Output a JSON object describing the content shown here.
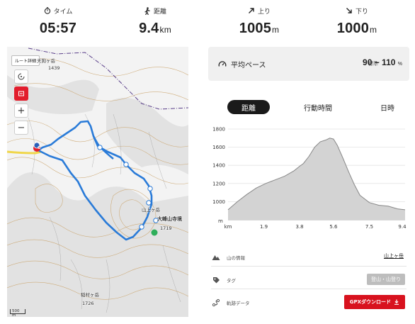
{
  "stats": [
    {
      "label": "タイム",
      "value": "05:57",
      "unit": "",
      "icon": "stopwatch-icon"
    },
    {
      "label": "距離",
      "value": "9.4",
      "unit": "km",
      "icon": "walker-icon"
    },
    {
      "label": "上り",
      "value": "1005",
      "unit": "m",
      "icon": "arrow-up-right-icon"
    },
    {
      "label": "下り",
      "value": "1000",
      "unit": "m",
      "icon": "arrow-down-right-icon"
    }
  ],
  "map": {
    "route_detail_label": "ルート詳細",
    "labels": {
      "peak_top": "天狗ヶ岳",
      "elev_top": "1439",
      "peak_mid": "山上ヶ岳",
      "temple": "大峰山寺境",
      "elev_mid": "1719",
      "peak_bottom": "稲村ヶ岳",
      "elev_bottom": "1726"
    },
    "start_marker": "G",
    "scale_label": "500 m",
    "zoom_in_label": "+",
    "zoom_out_label": "−"
  },
  "pace": {
    "title": "平均ペース",
    "sub_label": "標準",
    "range": "90 ~ 110",
    "unit": "%"
  },
  "tabs": [
    {
      "label": "距離",
      "active": true
    },
    {
      "label": "行動時間",
      "active": false
    },
    {
      "label": "日時",
      "active": false
    }
  ],
  "chart_data": {
    "type": "area",
    "xlabel": "km",
    "ylabel": "m",
    "x_ticks": [
      "1.9",
      "3.8",
      "5.6",
      "7.5",
      "9.4"
    ],
    "y_ticks": [
      "1800",
      "1600",
      "1400",
      "1200",
      "1000"
    ],
    "xlim": [
      0,
      9.4
    ],
    "ylim": [
      800,
      1800
    ],
    "x": [
      0.0,
      0.5,
      1.0,
      1.5,
      2.0,
      2.5,
      3.0,
      3.5,
      3.8,
      4.0,
      4.3,
      4.6,
      4.9,
      5.2,
      5.4,
      5.6,
      5.8,
      6.1,
      6.4,
      6.7,
      7.0,
      7.5,
      8.0,
      8.5,
      9.0,
      9.4
    ],
    "y": [
      910,
      1000,
      1080,
      1150,
      1200,
      1240,
      1280,
      1340,
      1390,
      1420,
      1500,
      1600,
      1660,
      1680,
      1700,
      1690,
      1620,
      1480,
      1330,
      1190,
      1070,
      990,
      960,
      950,
      920,
      910
    ],
    "fill_color": "#d3d3d3",
    "line_color": "#888888"
  },
  "rows": {
    "mountain_label": "山の情報",
    "mountain_value": "山上ヶ岳",
    "tag_label": "タグ",
    "tag_value": "登山・山登り",
    "track_label": "軌跡データ",
    "gpx_button": "GPXダウンロード"
  },
  "colors": {
    "route": "#2a7bd8",
    "accent_red": "#d8121e",
    "chart_fill": "#d3d3d3"
  }
}
